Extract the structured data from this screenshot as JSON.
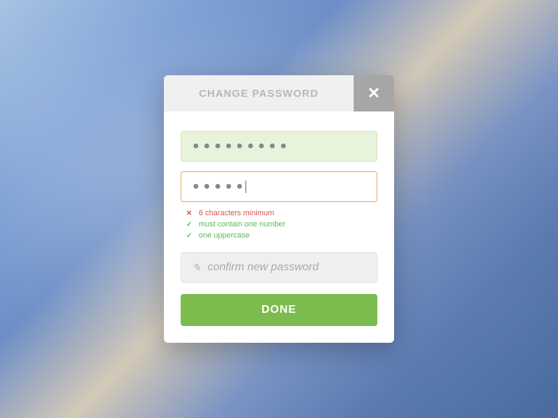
{
  "modal": {
    "title": "CHANGE PASSWORD",
    "current_password_display": "●●●●●●●●●",
    "new_password_display": "●●●●●",
    "confirm_placeholder": "confirm new password",
    "done_label": "DONE"
  },
  "validation": {
    "rule1": {
      "status": "invalid",
      "text": "6 characters minimum"
    },
    "rule2": {
      "status": "valid",
      "text": "must contain one number"
    },
    "rule3": {
      "status": "valid",
      "text": "one uppercase"
    }
  }
}
